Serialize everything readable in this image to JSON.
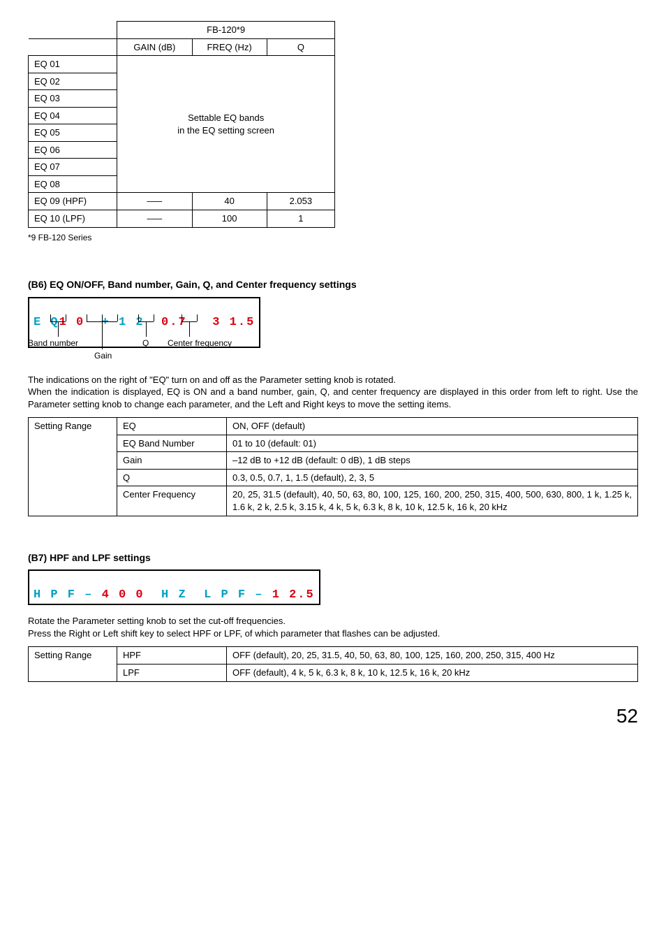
{
  "table1": {
    "header": {
      "col1": "FB-120*9",
      "sub1": "GAIN (dB)",
      "sub2": "FREQ (Hz)",
      "sub3": "Q"
    },
    "rows": [
      "EQ 01",
      "EQ 02",
      "EQ 03",
      "EQ 04",
      "EQ 05",
      "EQ 06",
      "EQ 07",
      "EQ 08"
    ],
    "mergedText1": "Settable EQ bands",
    "mergedText2": "in the EQ setting screen",
    "hpfRow": {
      "label": "EQ 09 (HPF)",
      "gain": "–––",
      "freq": "40",
      "q": "2.053"
    },
    "lpfRow": {
      "label": "EQ 10 (LPF)",
      "gain": "–––",
      "freq": "100",
      "q": "1"
    }
  },
  "footnote1": "*9 FB-120 Series",
  "b6": {
    "title": "(B6) EQ ON/OFF, Band number, Gain, Q, and Center frequency settings",
    "lcd": {
      "p1": "E Q",
      "p2": "1 0",
      "p3": "+ 1 2",
      "p4": "0.7",
      "p5": "3 1.5"
    },
    "labels": {
      "band": "Band number",
      "gain": "Gain",
      "q": "Q",
      "cf": "Center frequency"
    },
    "para1": "The indications on the right of \"EQ\" turn on and off as the Parameter setting knob is rotated.",
    "para2": "When the indication is displayed, EQ is ON and a band number, gain, Q, and center frequency are displayed in this order from left to right. Use the Parameter setting knob to change each parameter, and the Left and Right keys to move the setting items."
  },
  "table2": {
    "rangeLabel": "Setting Range",
    "rows": [
      {
        "k": "EQ",
        "v": "ON, OFF (default)"
      },
      {
        "k": "EQ Band Number",
        "v": "01 to 10 (default: 01)"
      },
      {
        "k": "Gain",
        "v": "–12 dB to +12 dB (default: 0 dB), 1 dB steps"
      },
      {
        "k": "Q",
        "v": "0.3, 0.5, 0.7, 1, 1.5 (default), 2, 3, 5"
      },
      {
        "k": "Center Frequency",
        "v": "20, 25, 31.5 (default), 40, 50, 63, 80, 100, 125, 160, 200, 250, 315, 400, 500, 630, 800, 1 k, 1.25 k, 1.6 k, 2 k, 2.5 k, 3.15 k, 4 k, 5 k, 6.3 k, 8 k, 10 k, 12.5 k, 16 k, 20 kHz"
      }
    ]
  },
  "b7": {
    "title": "(B7) HPF and LPF settings",
    "lcd": {
      "p1": "H P F",
      "dash1": "–",
      "p2": "4 0 0",
      "p3": "H Z",
      "p4": "L P F",
      "dash2": "–",
      "p5": "1 2.5"
    },
    "para1": "Rotate the Parameter setting knob to set the cut-off frequencies.",
    "para2": "Press the Right or Left shift key to select HPF or LPF, of which parameter that flashes can be adjusted."
  },
  "table3": {
    "rangeLabel": "Setting Range",
    "rows": [
      {
        "k": "HPF",
        "v": "OFF (default), 20, 25, 31.5, 40, 50, 63, 80, 100, 125, 160, 200, 250, 315, 400 Hz"
      },
      {
        "k": "LPF",
        "v": "OFF (default), 4 k, 5 k, 6.3 k, 8 k, 10 k, 12.5 k, 16 k, 20 kHz"
      }
    ]
  },
  "pageNumber": "52"
}
